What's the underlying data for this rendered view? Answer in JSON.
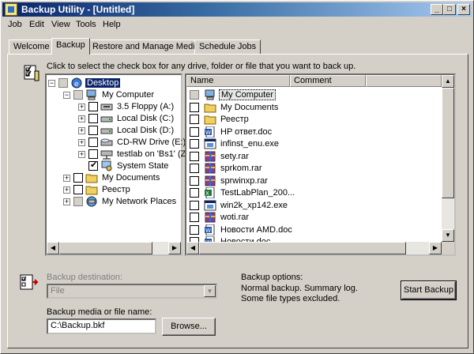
{
  "window": {
    "title": "Backup Utility - [Untitled]",
    "controls": [
      "_",
      "□",
      "×"
    ]
  },
  "menu": [
    "Job",
    "Edit",
    "View",
    "Tools",
    "Help"
  ],
  "tabs": [
    {
      "label": "Welcome",
      "active": false
    },
    {
      "label": "Backup",
      "active": true
    },
    {
      "label": "Restore and Manage Media",
      "active": false
    },
    {
      "label": "Schedule Jobs",
      "active": false
    }
  ],
  "instruction": "Click to select the check box for any drive, folder or file that you want to back up.",
  "tree": {
    "items": [
      {
        "label": "Desktop",
        "icon": "desktop-icon",
        "expander": "−",
        "check": "gray",
        "selected": true
      },
      {
        "label": "My Computer",
        "icon": "computer-icon",
        "expander": "−",
        "check": "gray"
      },
      {
        "label": "3.5 Floppy (A:)",
        "icon": "floppy-icon",
        "expander": "+",
        "check": "empty"
      },
      {
        "label": "Local Disk (C:)",
        "icon": "drive-icon",
        "expander": "+",
        "check": "empty"
      },
      {
        "label": "Local Disk (D:)",
        "icon": "drive-icon",
        "expander": "+",
        "check": "empty"
      },
      {
        "label": "CD-RW Drive (E:)",
        "icon": "cd-drive-icon",
        "expander": "+",
        "check": "empty"
      },
      {
        "label": "testlab on 'Bs1' (Z",
        "icon": "network-drive-icon",
        "expander": "+",
        "check": "empty"
      },
      {
        "label": "System State",
        "icon": "system-state-icon",
        "expander": "",
        "check": "checked"
      },
      {
        "label": "My Documents",
        "icon": "folder-icon",
        "expander": "+",
        "check": "empty"
      },
      {
        "label": "Реестр",
        "icon": "folder-icon",
        "expander": "+",
        "check": "empty"
      },
      {
        "label": "My Network Places",
        "icon": "network-icon",
        "expander": "+",
        "check": "gray"
      }
    ]
  },
  "files": {
    "columns": [
      "Name",
      "Comment"
    ],
    "rows": [
      {
        "name": "My Computer",
        "icon": "computer-icon",
        "check": "gray",
        "focused": true
      },
      {
        "name": "My Documents",
        "icon": "folder-icon",
        "check": "empty"
      },
      {
        "name": "Реестр",
        "icon": "folder-icon",
        "check": "empty"
      },
      {
        "name": "HP ответ.doc",
        "icon": "word-doc-icon",
        "check": "empty"
      },
      {
        "name": "infinst_enu.exe",
        "icon": "exe-icon",
        "check": "empty"
      },
      {
        "name": "sety.rar",
        "icon": "rar-icon",
        "check": "empty"
      },
      {
        "name": "sprkom.rar",
        "icon": "rar-icon",
        "check": "empty"
      },
      {
        "name": "sprwinxp.rar",
        "icon": "rar-icon",
        "check": "empty"
      },
      {
        "name": "TestLabPlan_200...",
        "icon": "excel-icon",
        "check": "empty"
      },
      {
        "name": "win2k_xp142.exe",
        "icon": "exe-icon",
        "check": "empty"
      },
      {
        "name": "woti.rar",
        "icon": "rar-icon",
        "check": "empty"
      },
      {
        "name": "Новости AMD.doc",
        "icon": "word-doc-icon",
        "check": "empty"
      },
      {
        "name": "Новости.doc",
        "icon": "word-doc-icon",
        "check": "empty"
      }
    ]
  },
  "destination": {
    "label": "Backup destination:",
    "value": "File"
  },
  "media": {
    "label": "Backup media or file name:",
    "value": "C:\\Backup.bkf",
    "browse_label": "Browse..."
  },
  "options": {
    "label": "Backup options:",
    "line1": "Normal backup.  Summary log.",
    "line2": "Some file types excluded."
  },
  "start_label": "Start Backup",
  "colors": {
    "selection": "#0a246a",
    "face": "#d4d0c8",
    "title_start": "#0a246a",
    "title_end": "#a6caf0"
  }
}
